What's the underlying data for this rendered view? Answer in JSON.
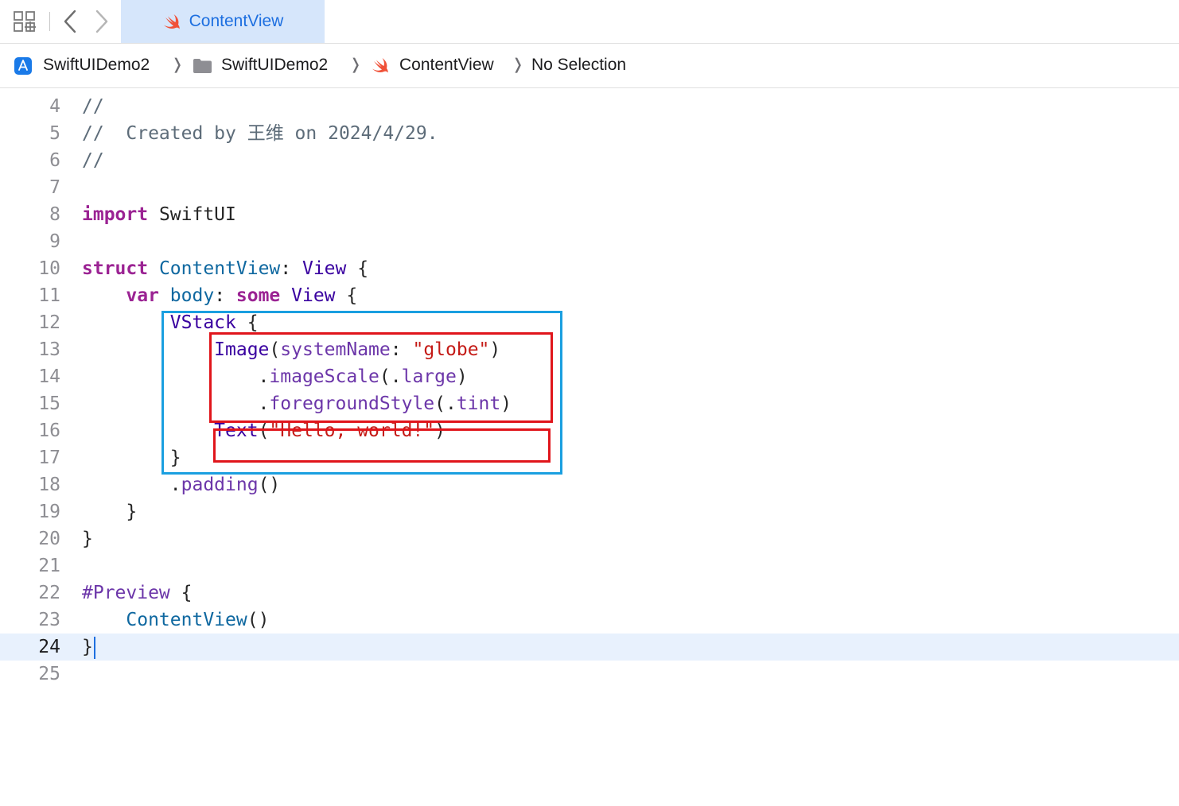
{
  "tab": {
    "title": "ContentView"
  },
  "breadcrumb": {
    "project": "SwiftUIDemo2",
    "folder": "SwiftUIDemo2",
    "file": "ContentView",
    "selection": "No Selection"
  },
  "icons": {
    "grid": "grid-icon",
    "back": "chevron-left-icon",
    "forward": "chevron-right-icon",
    "swift": "swift-icon",
    "project": "app-store-icon",
    "folder": "folder-icon"
  },
  "colors": {
    "tab_background": "#d6e6fb",
    "tab_text": "#1d6fe0",
    "current_line": "#e8f1fd",
    "annotation_blue": "#1a9fe0",
    "annotation_red": "#e0151b"
  },
  "editor": {
    "current_line": "24",
    "lines": [
      {
        "num": "4",
        "tokens": [
          {
            "t": "//",
            "c": "cm"
          }
        ]
      },
      {
        "num": "5",
        "tokens": [
          {
            "t": "//  Created by 王维 on 2024/4/29.",
            "c": "cm"
          }
        ]
      },
      {
        "num": "6",
        "tokens": [
          {
            "t": "//",
            "c": "cm"
          }
        ]
      },
      {
        "num": "7",
        "tokens": []
      },
      {
        "num": "8",
        "tokens": [
          {
            "t": "import",
            "c": "kw"
          },
          {
            "t": " SwiftUI",
            "c": ""
          }
        ]
      },
      {
        "num": "9",
        "tokens": []
      },
      {
        "num": "10",
        "tokens": [
          {
            "t": "struct",
            "c": "kw"
          },
          {
            "t": " ",
            "c": ""
          },
          {
            "t": "ContentView",
            "c": "tyd"
          },
          {
            "t": ": ",
            "c": ""
          },
          {
            "t": "View",
            "c": "ty"
          },
          {
            "t": " {",
            "c": ""
          }
        ]
      },
      {
        "num": "11",
        "tokens": [
          {
            "t": "    ",
            "c": ""
          },
          {
            "t": "var",
            "c": "kw"
          },
          {
            "t": " ",
            "c": ""
          },
          {
            "t": "body",
            "c": "tyd"
          },
          {
            "t": ": ",
            "c": ""
          },
          {
            "t": "some",
            "c": "kw"
          },
          {
            "t": " ",
            "c": ""
          },
          {
            "t": "View",
            "c": "ty"
          },
          {
            "t": " {",
            "c": ""
          }
        ]
      },
      {
        "num": "12",
        "tokens": [
          {
            "t": "        ",
            "c": ""
          },
          {
            "t": "VStack",
            "c": "ty"
          },
          {
            "t": " {",
            "c": ""
          }
        ]
      },
      {
        "num": "13",
        "tokens": [
          {
            "t": "            ",
            "c": ""
          },
          {
            "t": "Image",
            "c": "ty"
          },
          {
            "t": "(",
            "c": ""
          },
          {
            "t": "systemName",
            "c": "fn"
          },
          {
            "t": ": ",
            "c": ""
          },
          {
            "t": "\"globe\"",
            "c": "str"
          },
          {
            "t": ")",
            "c": ""
          }
        ]
      },
      {
        "num": "14",
        "tokens": [
          {
            "t": "                .",
            "c": ""
          },
          {
            "t": "imageScale",
            "c": "fn"
          },
          {
            "t": "(.",
            "c": ""
          },
          {
            "t": "large",
            "c": "fn"
          },
          {
            "t": ")",
            "c": ""
          }
        ]
      },
      {
        "num": "15",
        "tokens": [
          {
            "t": "                .",
            "c": ""
          },
          {
            "t": "foregroundStyle",
            "c": "fn"
          },
          {
            "t": "(.",
            "c": ""
          },
          {
            "t": "tint",
            "c": "fn"
          },
          {
            "t": ")",
            "c": ""
          }
        ]
      },
      {
        "num": "16",
        "tokens": [
          {
            "t": "            ",
            "c": ""
          },
          {
            "t": "Text",
            "c": "ty"
          },
          {
            "t": "(",
            "c": ""
          },
          {
            "t": "\"Hello, world!\"",
            "c": "str"
          },
          {
            "t": ")",
            "c": ""
          }
        ]
      },
      {
        "num": "17",
        "tokens": [
          {
            "t": "        }",
            "c": ""
          }
        ]
      },
      {
        "num": "18",
        "tokens": [
          {
            "t": "        .",
            "c": ""
          },
          {
            "t": "padding",
            "c": "fn"
          },
          {
            "t": "()",
            "c": ""
          }
        ]
      },
      {
        "num": "19",
        "tokens": [
          {
            "t": "    }",
            "c": ""
          }
        ]
      },
      {
        "num": "20",
        "tokens": [
          {
            "t": "}",
            "c": ""
          }
        ]
      },
      {
        "num": "21",
        "tokens": []
      },
      {
        "num": "22",
        "tokens": [
          {
            "t": "#Preview",
            "c": "fn"
          },
          {
            "t": " {",
            "c": ""
          }
        ]
      },
      {
        "num": "23",
        "tokens": [
          {
            "t": "    ",
            "c": ""
          },
          {
            "t": "ContentView",
            "c": "tyd"
          },
          {
            "t": "()",
            "c": ""
          }
        ]
      },
      {
        "num": "24",
        "tokens": [
          {
            "t": "}",
            "c": ""
          }
        ]
      },
      {
        "num": "25",
        "tokens": []
      }
    ]
  }
}
